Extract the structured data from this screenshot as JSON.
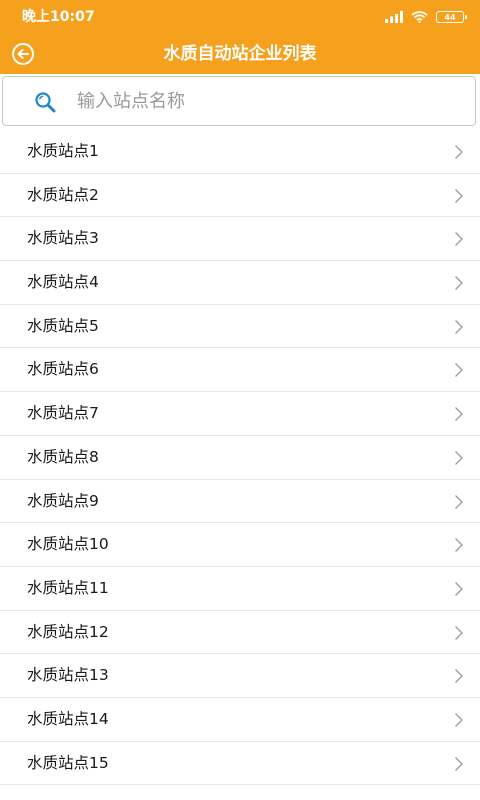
{
  "status_bar": {
    "time": "晚上10:07",
    "battery": "44",
    "icons": [
      "signal-icon",
      "wifi-icon",
      "battery-icon"
    ]
  },
  "toolbar": {
    "title": "水质自动站企业列表",
    "back_icon": "back-arrow-icon"
  },
  "search": {
    "placeholder": "输入站点名称",
    "value": "",
    "icon": "search-icon"
  },
  "stations": [
    {
      "label": "水质站点1"
    },
    {
      "label": "水质站点2"
    },
    {
      "label": "水质站点3"
    },
    {
      "label": "水质站点4"
    },
    {
      "label": "水质站点5"
    },
    {
      "label": "水质站点6"
    },
    {
      "label": "水质站点7"
    },
    {
      "label": "水质站点8"
    },
    {
      "label": "水质站点9"
    },
    {
      "label": "水质站点10"
    },
    {
      "label": "水质站点11"
    },
    {
      "label": "水质站点12"
    },
    {
      "label": "水质站点13"
    },
    {
      "label": "水质站点14"
    },
    {
      "label": "水质站点15"
    }
  ],
  "colors": {
    "accent": "#f6a11e",
    "search_icon": "#1e88c8",
    "chevron": "#9a9a9a"
  }
}
